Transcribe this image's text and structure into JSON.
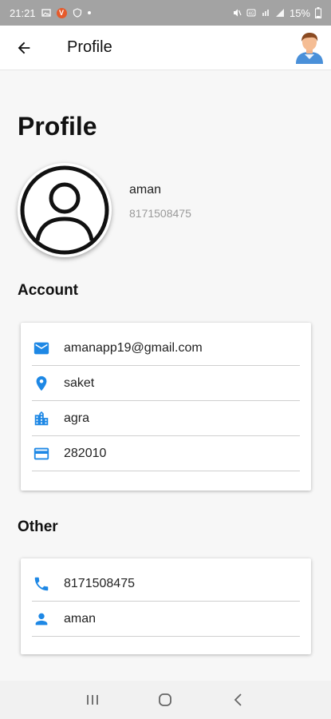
{
  "status_bar": {
    "time": "21:21",
    "battery": "15%"
  },
  "app_bar": {
    "title": "Profile"
  },
  "page": {
    "heading": "Profile"
  },
  "user": {
    "name": "aman",
    "phone": "8171508475"
  },
  "account": {
    "title": "Account",
    "items": [
      {
        "icon": "email-icon",
        "value": "amanapp19@gmail.com"
      },
      {
        "icon": "location-pin-icon",
        "value": "saket"
      },
      {
        "icon": "city-icon",
        "value": "agra"
      },
      {
        "icon": "card-icon",
        "value": "282010"
      }
    ]
  },
  "other": {
    "title": "Other",
    "items": [
      {
        "icon": "phone-icon",
        "value": "8171508475"
      },
      {
        "icon": "person-icon",
        "value": "aman"
      }
    ]
  },
  "colors": {
    "accent": "#1e88e5",
    "status_bar": "#a3a3a3"
  }
}
